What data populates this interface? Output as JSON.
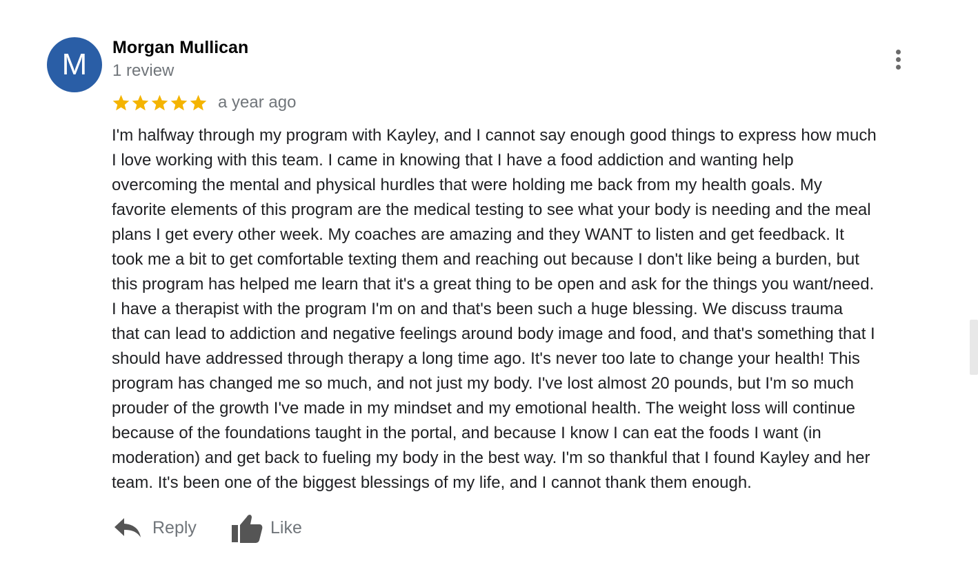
{
  "reviewer": {
    "initial": "M",
    "name": "Morgan Mullican",
    "review_count": "1 review",
    "avatar_color": "#2a5ea6"
  },
  "rating": {
    "stars": 5,
    "max_stars": 5,
    "star_color": "#f4b400",
    "date": "a year ago"
  },
  "review": {
    "text": "I'm halfway through my program with Kayley, and I cannot say enough good things to express how much\nI love working with this team.  I came in knowing that I have a food addiction and wanting help\novercoming the mental and physical hurdles that were holding me back from my health goals.  My\nfavorite elements of this program are the medical testing to see what your body is needing and the meal\nplans I get every other week.  My coaches are amazing and they WANT to listen and get feedback.  It\ntook me a bit to get comfortable texting them and reaching out because I don't like being a burden, but\nthis program has helped me learn that it's a great thing to be open and ask for the things you want/need.\nI have a therapist with the program I'm on and that's been such a huge blessing.  We discuss trauma\nthat can lead to addiction and negative feelings around body image and food, and that's something that I\nshould have addressed through therapy a long time ago.  It's never too late to change your health! This\nprogram has changed me so much, and not just my body.  I've lost almost 20 pounds, but I'm so much\nprouder of the growth I've made in my mindset and my emotional health.  The weight loss will continue\nbecause of the foundations taught in the portal, and because I know I can eat the foods I want (in\nmoderation) and get back to fueling my body in the best way.  I'm so thankful that I found Kayley and her\nteam.  It's been one of the biggest blessings of my life, and I cannot thank them enough."
  },
  "actions": {
    "reply_label": "Reply",
    "like_label": "Like",
    "reply_icon": "reply-arrow-icon",
    "like_icon": "thumbs-up-icon",
    "more_icon": "more-vertical-icon"
  }
}
